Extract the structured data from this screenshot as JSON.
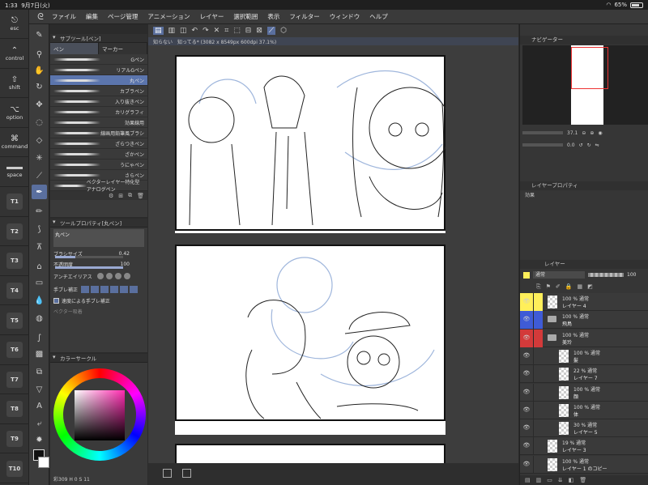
{
  "status": {
    "time": "1:33",
    "date": "9月7日(火)",
    "battery": "65%"
  },
  "keybar": {
    "keys": [
      {
        "label": "esc",
        "glyph": "⎋"
      },
      {
        "label": "control",
        "glyph": "⌃"
      },
      {
        "label": "shift",
        "glyph": "⇧"
      },
      {
        "label": "option",
        "glyph": "⌥"
      },
      {
        "label": "command",
        "glyph": "⌘"
      },
      {
        "label": "space",
        "glyph": ""
      },
      {
        "label": "T1"
      },
      {
        "label": "T2"
      },
      {
        "label": "T3"
      },
      {
        "label": "T4"
      },
      {
        "label": "T5"
      },
      {
        "label": "T6"
      },
      {
        "label": "T7"
      },
      {
        "label": "T8"
      },
      {
        "label": "T9"
      },
      {
        "label": "T10"
      }
    ]
  },
  "menu": [
    "ファイル",
    "編集",
    "ページ管理",
    "アニメーション",
    "レイヤー",
    "選択範囲",
    "表示",
    "フィルター",
    "ウィンドウ",
    "ヘルプ"
  ],
  "document": {
    "tab_title": "知らない　知ってる* (3082 x 8549px 600dpi 37.1%)"
  },
  "subtool": {
    "title": "サブツール[ペン]",
    "tabs": [
      "ペン",
      "マーカー"
    ],
    "brushes": [
      "Gペン",
      "リアルGペン",
      "丸ペン",
      "カブラペン",
      "入り抜きペン",
      "カリグラフィ",
      "効果線用",
      "線画用鉛筆風ブラシ",
      "ざらつきペン",
      "ざかペン",
      "うにゃペン",
      "さらペン",
      "ベクターレイヤー特化型アナログペン"
    ],
    "selected_brush": "丸ペン"
  },
  "toolprop": {
    "title": "ツールプロパティ[丸ペン]",
    "preview_name": "丸ペン",
    "brush_size_label": "ブラシサイズ",
    "brush_size": "0.42",
    "opacity_label": "不透明度",
    "opacity": "100",
    "antialias_label": "アンチエイリアス",
    "stabilization_label": "手ブレ補正",
    "speed_stab_label": "速度による手ブレ補正",
    "vector_label": "ベクター吸着"
  },
  "colorcircle": {
    "title": "カラーサークル",
    "readout": "彩309 H 0 S 11"
  },
  "navigator": {
    "title": "ナビゲーター",
    "zoom": "37.1",
    "angle": "0.0"
  },
  "layerprop": {
    "title": "レイヤープロパティ",
    "effect_label": "効果"
  },
  "layerpanel": {
    "title": "レイヤー",
    "blend": "通常",
    "opacity": "100",
    "layers": [
      {
        "pct": "100 % 通常",
        "name": "レイヤー 4",
        "kind": "raster",
        "indent": 0,
        "tag": "#ffef5a"
      },
      {
        "pct": "100 % 通常",
        "name": "飛鳥",
        "kind": "folder",
        "indent": 0,
        "tag": "#3f5bd6"
      },
      {
        "pct": "100 % 通常",
        "name": "美玲",
        "kind": "folder",
        "indent": 0,
        "tag": "#d33a3a"
      },
      {
        "pct": "100 % 通常",
        "name": "髪",
        "kind": "raster",
        "indent": 1,
        "tag": ""
      },
      {
        "pct": "22 % 通常",
        "name": "レイヤー 7",
        "kind": "raster",
        "indent": 1,
        "tag": ""
      },
      {
        "pct": "100 % 通常",
        "name": "顔",
        "kind": "raster",
        "indent": 1,
        "tag": ""
      },
      {
        "pct": "100 % 通常",
        "name": "体",
        "kind": "raster",
        "indent": 1,
        "tag": ""
      },
      {
        "pct": "30 % 通常",
        "name": "レイヤー 5",
        "kind": "raster",
        "indent": 1,
        "tag": ""
      },
      {
        "pct": "19 % 通常",
        "name": "レイヤー 3",
        "kind": "raster",
        "indent": 0,
        "tag": ""
      },
      {
        "pct": "100 % 通常",
        "name": "レイヤー 1 のコピー",
        "kind": "raster",
        "indent": 0,
        "tag": ""
      }
    ]
  }
}
